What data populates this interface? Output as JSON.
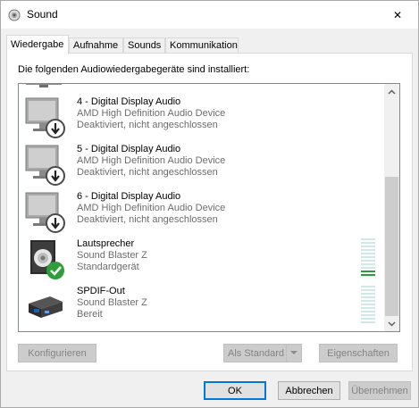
{
  "window": {
    "title": "Sound",
    "close_glyph": "✕"
  },
  "tabs": [
    {
      "label": "Wiedergabe",
      "active": true
    },
    {
      "label": "Aufnahme",
      "active": false
    },
    {
      "label": "Sounds",
      "active": false
    },
    {
      "label": "Kommunikation",
      "active": false
    }
  ],
  "instruction": "Die folgenden Audiowiedergabegeräte sind installiert:",
  "devices": [
    {
      "name": "4 - Digital Display Audio",
      "description": "AMD High Definition Audio Device",
      "status": "Deaktiviert, nicht angeschlossen",
      "icon": "monitor-icon",
      "badge": "disabled-arrow-badge"
    },
    {
      "name": "5 - Digital Display Audio",
      "description": "AMD High Definition Audio Device",
      "status": "Deaktiviert, nicht angeschlossen",
      "icon": "monitor-icon",
      "badge": "disabled-arrow-badge"
    },
    {
      "name": "6 - Digital Display Audio",
      "description": "AMD High Definition Audio Device",
      "status": "Deaktiviert, nicht angeschlossen",
      "icon": "monitor-icon",
      "badge": "disabled-arrow-badge"
    },
    {
      "name": "Lautsprecher",
      "description": "Sound Blaster Z",
      "status": "Standardgerät",
      "icon": "speaker-icon",
      "badge": "default-check-badge"
    },
    {
      "name": "SPDIF-Out",
      "description": "Sound Blaster Z",
      "status": "Bereit",
      "icon": "spdif-icon",
      "badge": ""
    }
  ],
  "level_meters": {
    "lautsprecher_level": 0.2,
    "spdif_level": 0.0
  },
  "buttons": {
    "configure": "Konfigurieren",
    "set_default": "Als Standard",
    "properties": "Eigenschaften",
    "ok": "OK",
    "cancel": "Abbrechen",
    "apply": "Übernehmen"
  },
  "colors": {
    "accent": "#0078d7",
    "meter_on": "#2d9c3b",
    "meter_off": "#cfe8e8",
    "default_badge": "#2e9e3a"
  }
}
